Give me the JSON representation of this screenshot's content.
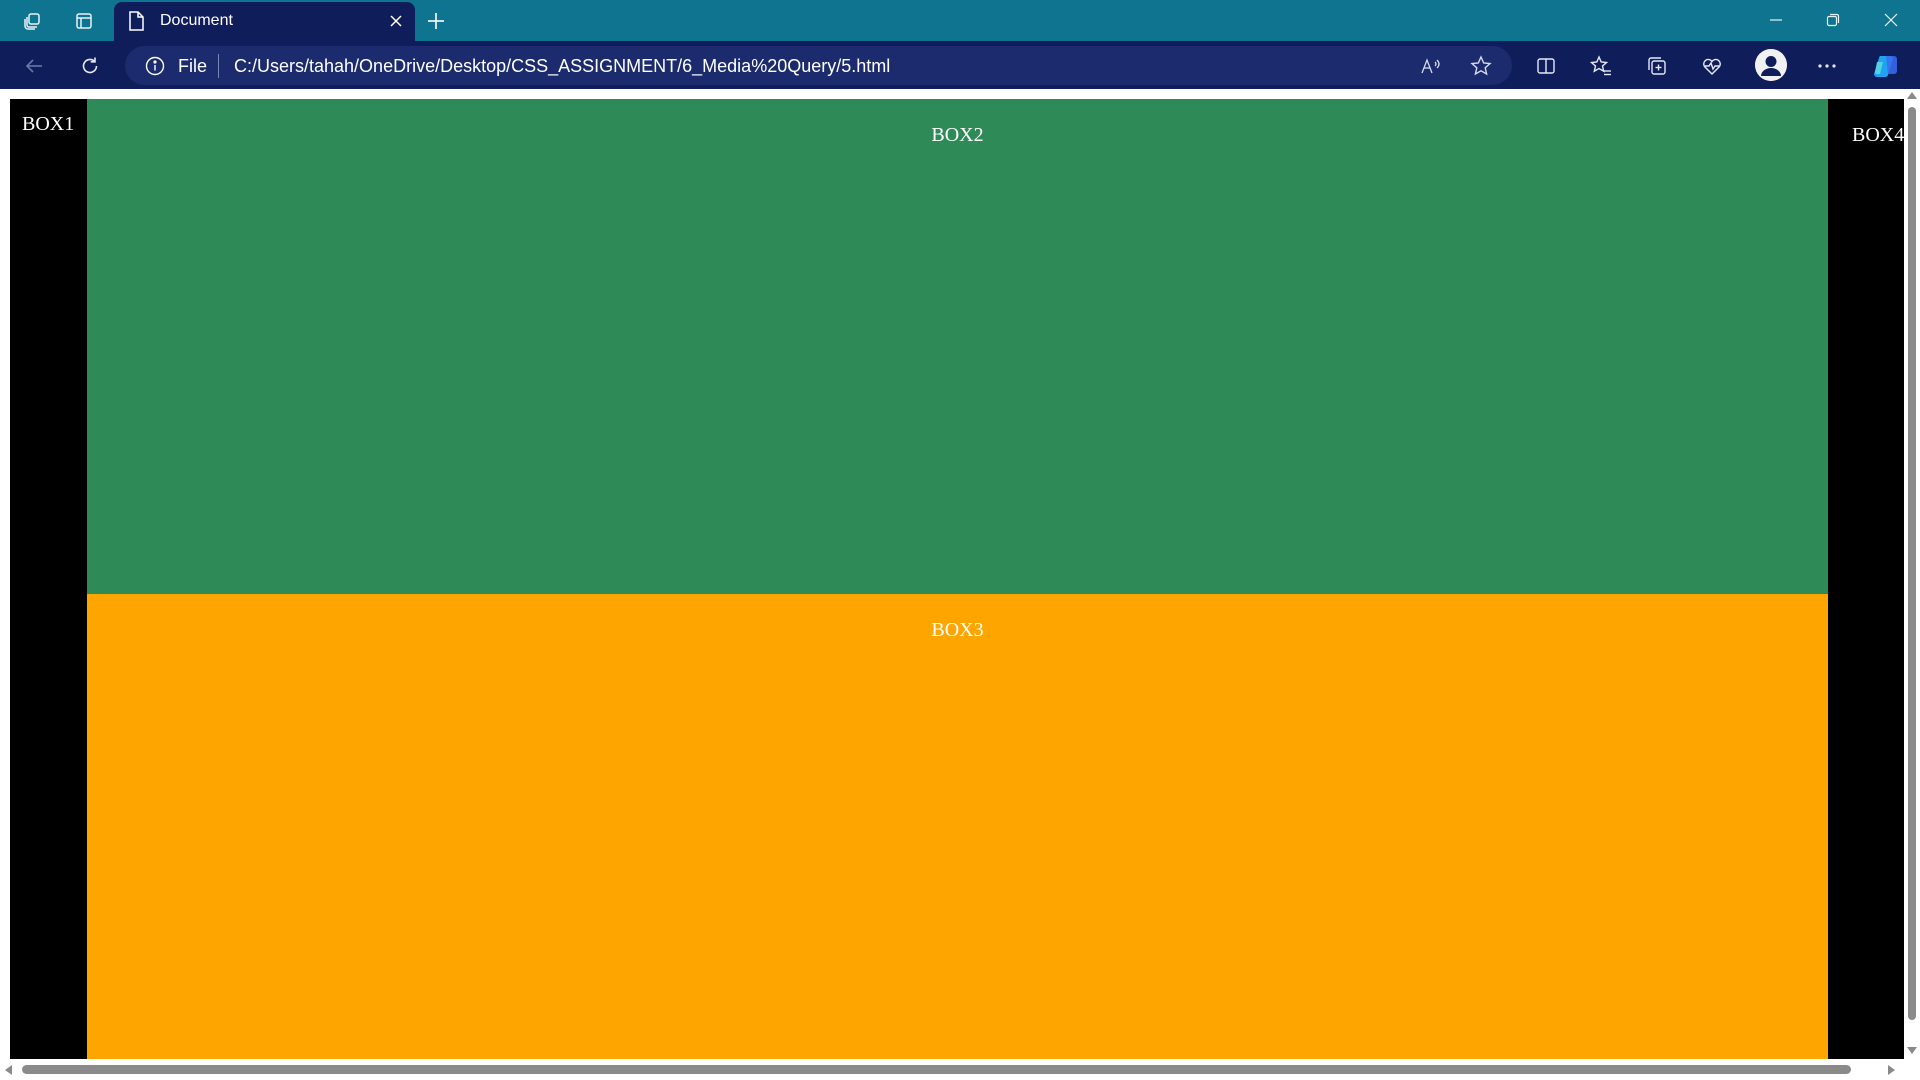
{
  "browser": {
    "tab": {
      "title": "Document"
    },
    "address_bar": {
      "scheme_label": "File",
      "url": "C:/Users/tahah/OneDrive/Desktop/CSS_ASSIGNMENT/6_Media%20Query/5.html"
    },
    "colors": {
      "tabstrip": "#0e7490",
      "toolbar": "#0f1d5a",
      "address_bar": "#1c2b6e"
    }
  },
  "page": {
    "boxes": [
      {
        "label": "BOX1",
        "color": "#000000"
      },
      {
        "label": "BOX2",
        "color": "#2e8b57"
      },
      {
        "label": "BOX3",
        "color": "#ffa500"
      },
      {
        "label": "BOX4",
        "color": "#000000"
      }
    ]
  }
}
